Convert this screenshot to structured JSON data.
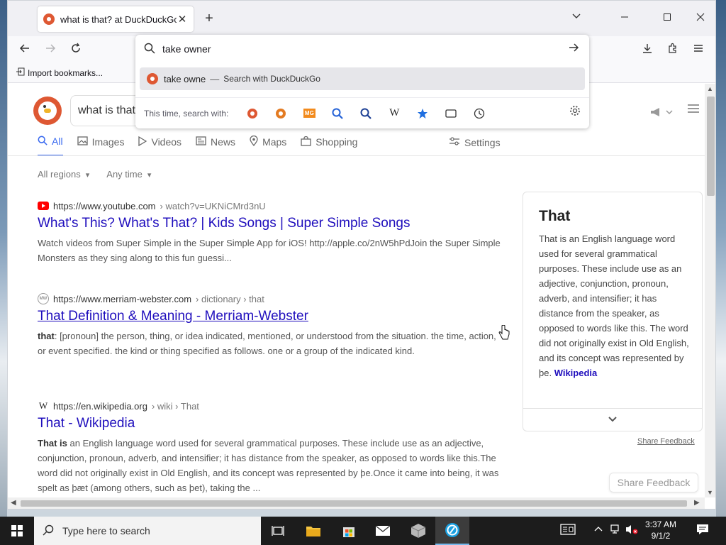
{
  "browser": {
    "tab_title": "what is that? at DuckDuckGo",
    "bookmark_label": "Import bookmarks...",
    "url_value": "take owner",
    "suggestion_query": "take owne",
    "suggestion_desc": "Search with DuckDuckGo",
    "oneoff_label": "This time, search with:",
    "oneoff_engines": [
      "duckduckgo-icon",
      "duckduckgo-icon",
      "mg-icon",
      "search-icon",
      "search-icon",
      "wikipedia-icon",
      "bookmarks-star-icon",
      "tabs-icon",
      "history-icon"
    ],
    "wiki_glyph": "W",
    "mg_glyph": "MG"
  },
  "ddg": {
    "search_text": "what is that",
    "tabs": [
      {
        "label": "All",
        "icon": "search-icon"
      },
      {
        "label": "Images",
        "icon": "image-icon"
      },
      {
        "label": "Videos",
        "icon": "play-icon"
      },
      {
        "label": "News",
        "icon": "newspaper-icon"
      },
      {
        "label": "Maps",
        "icon": "map-pin-icon"
      },
      {
        "label": "Shopping",
        "icon": "bag-icon"
      }
    ],
    "settings_label": "Settings",
    "filters": [
      "All regions",
      "Any time"
    ],
    "results": [
      {
        "domain": "https://www.youtube.com",
        "path": " › watch?v=UKNiCMrd3nU",
        "title": "What's This? What's That? | Kids Songs | Super Simple Songs",
        "snippet": "Watch videos from Super Simple in the Super Simple App for iOS! http://apple.co/2nW5hPdJoin the Super Simple Monsters as they sing along to this fun guessi..."
      },
      {
        "domain": "https://www.merriam-webster.com",
        "path": " › dictionary › that",
        "title": "That Definition & Meaning - Merriam-Webster",
        "snippet_bold": "that",
        "snippet": ": [pronoun] the person, thing, or idea indicated, mentioned, or understood from the situation. the time, action, or event specified. the kind or thing specified as follows. one or a group of the indicated kind.",
        "fav": "MW"
      },
      {
        "domain": "https://en.wikipedia.org",
        "path": " › wiki › That",
        "title": "That - Wikipedia",
        "snippet_bold": "That is",
        "snippet": " an English language word used for several grammatical purposes. These include use as an adjective, conjunction, pronoun, adverb, and intensifier; it has distance from the speaker, as opposed to words like this.The word did not originally exist in Old English, and its concept was represented by þe.Once it came into being, it was spelt as þæt (among others, such as þet), taking the ...",
        "fav": "W"
      }
    ],
    "panel": {
      "title": "That",
      "body": "That is an English language word used for several grammatical purposes. These include use as an adjective, conjunction, pronoun, adverb, and intensifier; it has distance from the speaker, as opposed to words like this. The word did not originally exist in Old English, and its concept was represented by þe. ",
      "link": "Wikipedia"
    },
    "share_feedback_link": "Share Feedback",
    "share_feedback_button": "Share Feedback"
  },
  "taskbar": {
    "search_placeholder": "Type here to search",
    "time": "3:37 AM",
    "date": "9/1/2"
  },
  "colors": {
    "ddg_orange": "#de5833",
    "link_blue": "#1f0ebd",
    "active_tab": "#3969ef"
  }
}
